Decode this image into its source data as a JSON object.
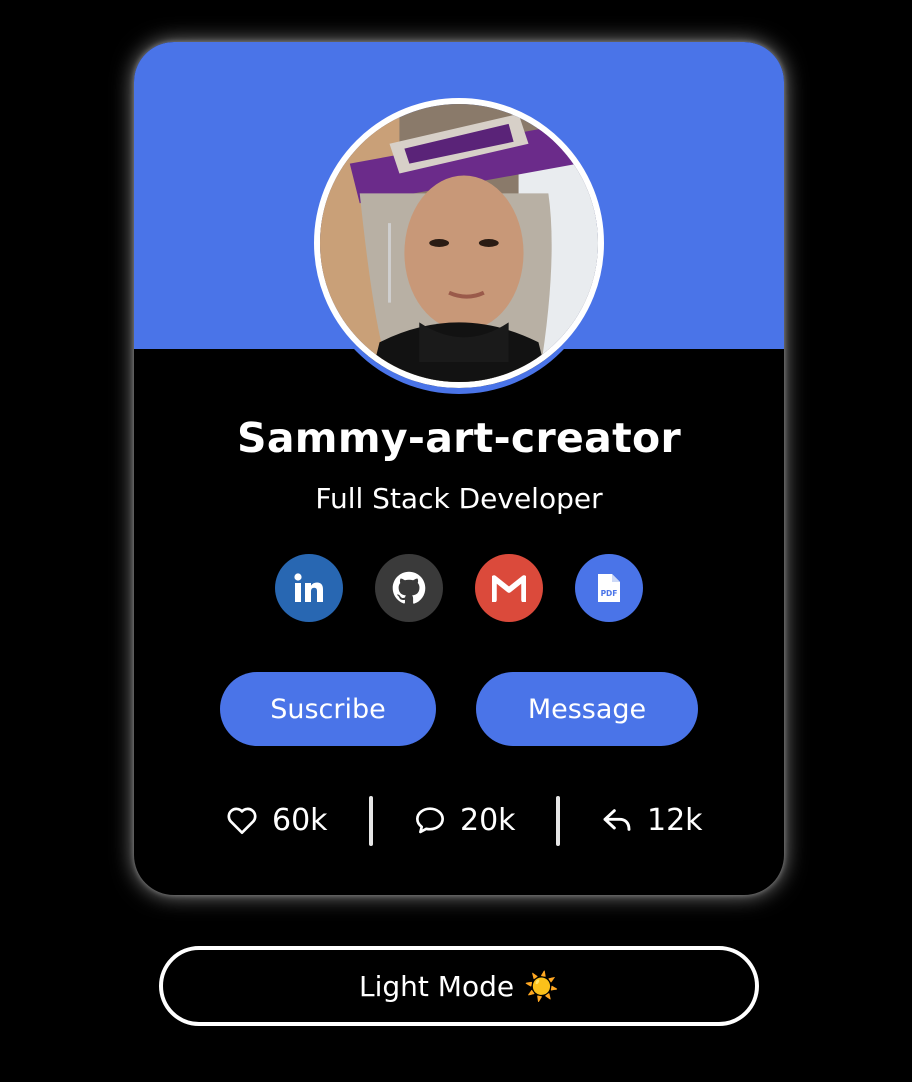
{
  "profile": {
    "name": "Sammy-art-creator",
    "role": "Full Stack Developer"
  },
  "social": [
    {
      "id": "linkedin",
      "icon": "linkedin-icon",
      "color": "#2867b2"
    },
    {
      "id": "github",
      "icon": "github-icon",
      "color": "#3a3a3a"
    },
    {
      "id": "gmail",
      "icon": "gmail-icon",
      "color": "#db4a3b"
    },
    {
      "id": "resume",
      "icon": "pdf-file-icon",
      "color": "#4a74e8",
      "label": "PDF"
    }
  ],
  "actions": {
    "subscribe_label": "Suscribe",
    "message_label": "Message"
  },
  "stats": {
    "likes": "60k",
    "comments": "20k",
    "shares": "12k"
  },
  "theme_toggle": {
    "label": "Light Mode",
    "icon": "☀️"
  },
  "colors": {
    "accent": "#4a74e8",
    "background": "#000000",
    "text": "#ffffff"
  }
}
